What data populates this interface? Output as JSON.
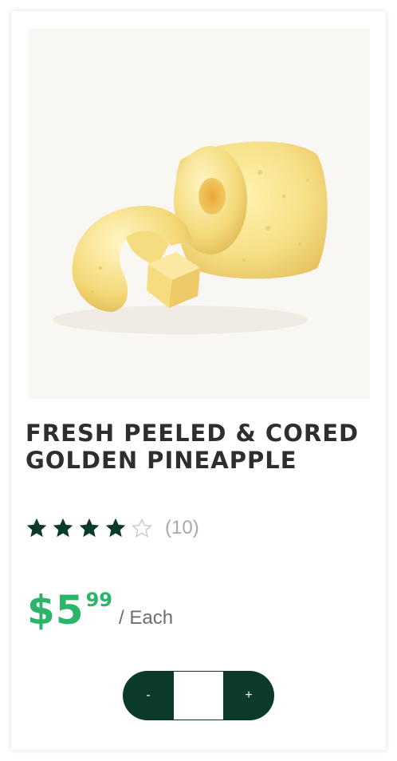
{
  "product": {
    "name": "FRESH PEELED & CORED GOLDEN PINEAPPLE",
    "image_alt": "Peeled and cored golden pineapple pieces",
    "rating": {
      "value": 4,
      "max": 5,
      "count_label": "(10)",
      "filled_color": "#0a3a2a",
      "empty_color": "#c8c8c8"
    },
    "price": {
      "dollars": "$5",
      "cents": "99",
      "unit": "/ Each",
      "color": "#2cb56a"
    }
  },
  "quantity": {
    "minus_label": "-",
    "plus_label": "+",
    "value": "",
    "button_color": "#0a3a2a"
  },
  "icons": {
    "star_filled": "star-filled-icon",
    "star_empty": "star-empty-icon"
  }
}
